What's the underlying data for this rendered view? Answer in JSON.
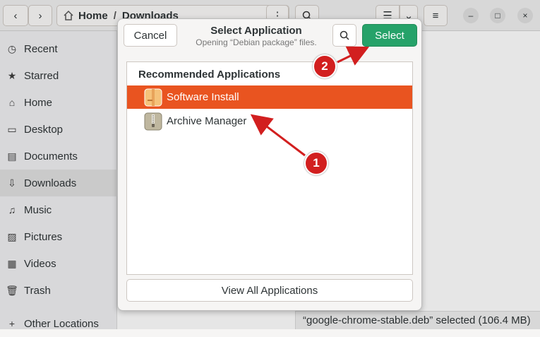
{
  "header": {
    "back_glyph": "‹",
    "forward_glyph": "›",
    "path": [
      "Home",
      "Downloads"
    ],
    "path_sep": "/",
    "window_controls": [
      "–",
      "□",
      "×"
    ]
  },
  "sidebar": {
    "items": [
      {
        "label": "Recent",
        "icon": "clock-icon",
        "glyph": "◷"
      },
      {
        "label": "Starred",
        "icon": "star-icon",
        "glyph": "★"
      },
      {
        "label": "Home",
        "icon": "home-icon",
        "glyph": "⌂"
      },
      {
        "label": "Desktop",
        "icon": "desktop-icon",
        "glyph": "▭"
      },
      {
        "label": "Documents",
        "icon": "document-icon",
        "glyph": "▤"
      },
      {
        "label": "Downloads",
        "icon": "download-icon",
        "glyph": "⇩"
      },
      {
        "label": "Music",
        "icon": "music-icon",
        "glyph": "♫"
      },
      {
        "label": "Pictures",
        "icon": "picture-icon",
        "glyph": "▨"
      },
      {
        "label": "Videos",
        "icon": "video-icon",
        "glyph": "▦"
      },
      {
        "label": "Trash",
        "icon": "trash-icon",
        "glyph": "🗑"
      },
      {
        "label": "Other Locations",
        "icon": "plus-icon",
        "glyph": "+"
      }
    ],
    "active": "Downloads"
  },
  "status": {
    "text": "“google-chrome-stable.deb” selected (106.4 MB)"
  },
  "dialog": {
    "cancel_label": "Cancel",
    "title": "Select Application",
    "subtitle": "Opening “Debian package” files.",
    "select_label": "Select",
    "list_heading": "Recommended Applications",
    "apps": [
      {
        "label": "Software Install",
        "selected": true
      },
      {
        "label": "Archive Manager",
        "selected": false
      }
    ],
    "view_all_label": "View All Applications"
  },
  "annotations": [
    {
      "number": "1"
    },
    {
      "number": "2"
    }
  ],
  "colors": {
    "accent_selected": "#e95420",
    "select_button": "#26a269",
    "annotation_red": "#d21f1f"
  }
}
